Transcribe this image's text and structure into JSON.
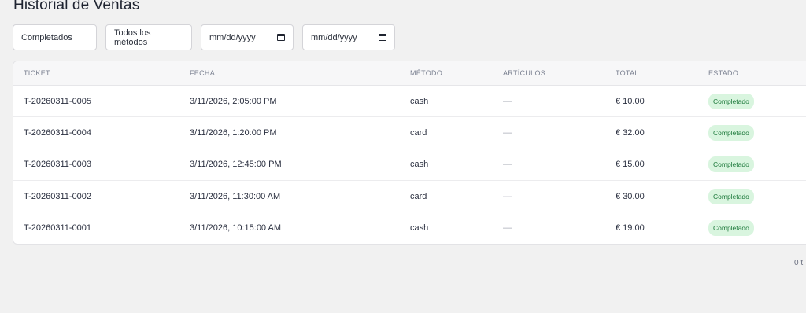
{
  "page": {
    "title": "Historial de Ventas"
  },
  "filters": {
    "status": "Completados",
    "method": "Todos los métodos",
    "date_from_placeholder": "mm/dd/yyyy",
    "date_to_placeholder": "mm/dd/yyyy"
  },
  "table": {
    "headers": [
      "TICKET",
      "FECHA",
      "MÉTODO",
      "ARTÍCULOS",
      "TOTAL",
      "ESTADO"
    ],
    "rows": [
      {
        "ticket": "T-20260311-0005",
        "fecha": "3/11/2026, 2:05:00 PM",
        "metodo": "cash",
        "articulos": "—",
        "total": "€ 10.00",
        "estado": "Completado"
      },
      {
        "ticket": "T-20260311-0004",
        "fecha": "3/11/2026, 1:20:00 PM",
        "metodo": "card",
        "articulos": "—",
        "total": "€ 32.00",
        "estado": "Completado"
      },
      {
        "ticket": "T-20260311-0003",
        "fecha": "3/11/2026, 12:45:00 PM",
        "metodo": "cash",
        "articulos": "—",
        "total": "€ 15.00",
        "estado": "Completado"
      },
      {
        "ticket": "T-20260311-0002",
        "fecha": "3/11/2026, 11:30:00 AM",
        "metodo": "card",
        "articulos": "—",
        "total": "€ 30.00",
        "estado": "Completado"
      },
      {
        "ticket": "T-20260311-0001",
        "fecha": "3/11/2026, 10:15:00 AM",
        "metodo": "cash",
        "articulos": "—",
        "total": "€ 19.00",
        "estado": "Completado"
      }
    ]
  },
  "pagination": {
    "text": "0 t"
  },
  "colors": {
    "badge_bg": "#d9f5df",
    "badge_text": "#1e7a3c",
    "page_bg": "#f1f1f1"
  },
  "icons": {
    "date_picker": "calendar-icon"
  }
}
